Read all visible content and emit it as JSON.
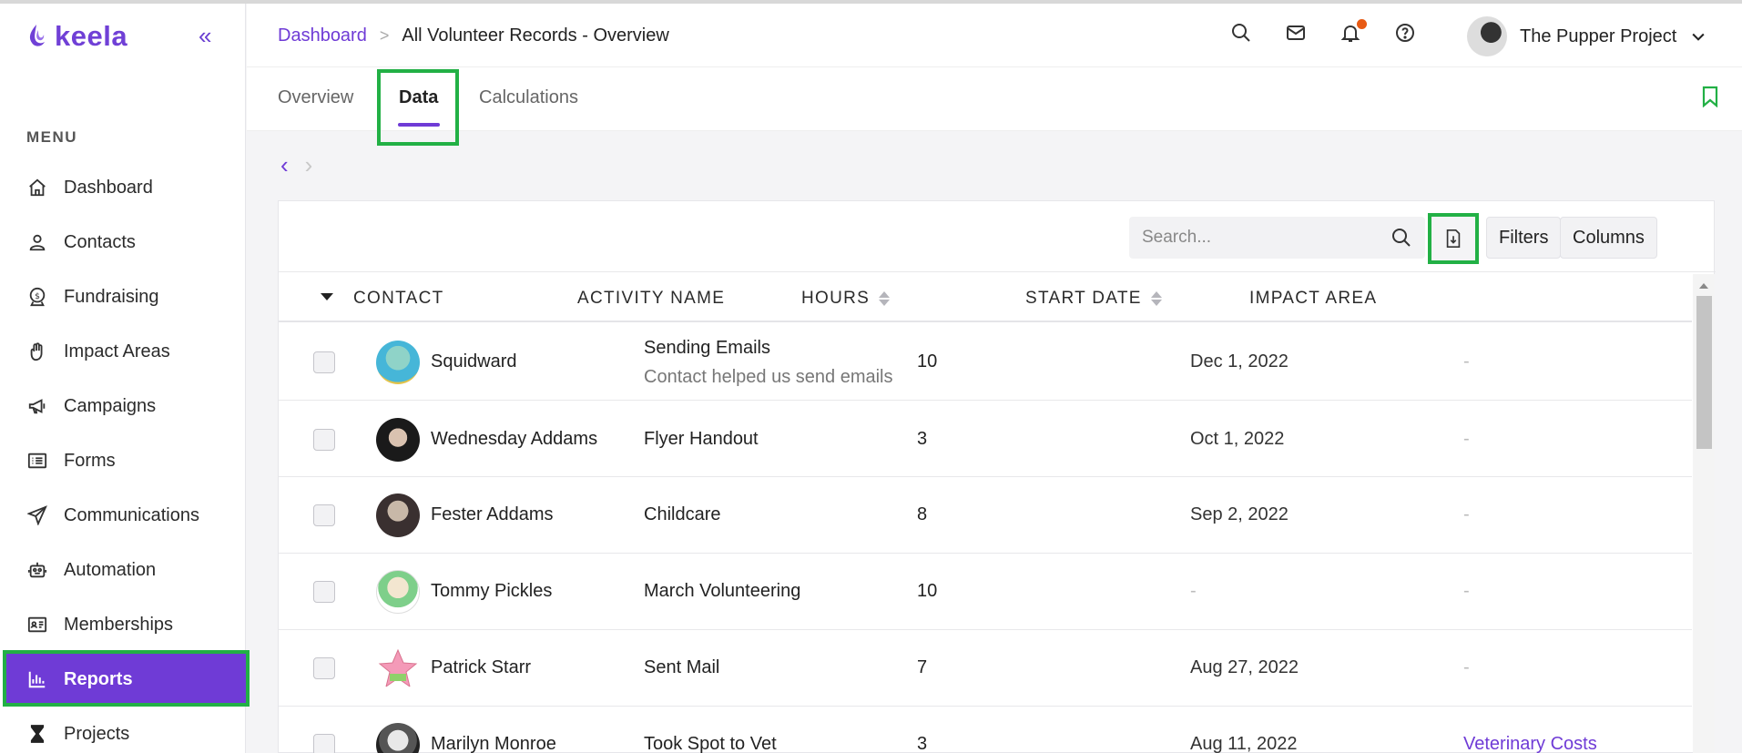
{
  "app": {
    "logo_text": "keela",
    "brand_color": "#6f3bd6",
    "highlight_color": "#22b045"
  },
  "sidebar": {
    "menu_title": "MENU",
    "items": [
      {
        "label": "Dashboard",
        "icon": "home-icon"
      },
      {
        "label": "Contacts",
        "icon": "person-icon"
      },
      {
        "label": "Fundraising",
        "icon": "dollar-badge-icon"
      },
      {
        "label": "Impact Areas",
        "icon": "hand-icon"
      },
      {
        "label": "Campaigns",
        "icon": "megaphone-icon"
      },
      {
        "label": "Forms",
        "icon": "list-icon"
      },
      {
        "label": "Communications",
        "icon": "paper-plane-icon"
      },
      {
        "label": "Automation",
        "icon": "robot-icon"
      },
      {
        "label": "Memberships",
        "icon": "id-card-icon"
      },
      {
        "label": "Reports",
        "icon": "bar-chart-icon",
        "active": true
      },
      {
        "label": "Projects",
        "icon": "hourglass-icon"
      }
    ]
  },
  "header": {
    "breadcrumb_link": "Dashboard",
    "breadcrumb_current": "All Volunteer Records - Overview",
    "org_name": "The Pupper Project"
  },
  "tabs": [
    {
      "label": "Overview"
    },
    {
      "label": "Data",
      "active": true
    },
    {
      "label": "Calculations"
    }
  ],
  "toolbar": {
    "search_placeholder": "Search...",
    "filters_label": "Filters",
    "columns_label": "Columns"
  },
  "table": {
    "columns": [
      "CONTACT",
      "ACTIVITY NAME",
      "HOURS",
      "START DATE",
      "IMPACT AREA"
    ],
    "rows": [
      {
        "contact": "Squidward",
        "activity": "Sending Emails",
        "activity_note": "Contact helped us send emails",
        "hours": "10",
        "start_date": "Dec 1, 2022",
        "impact_area": "-"
      },
      {
        "contact": "Wednesday Addams",
        "activity": "Flyer Handout",
        "hours": "3",
        "start_date": "Oct 1, 2022",
        "impact_area": "-"
      },
      {
        "contact": "Fester Addams",
        "activity": "Childcare",
        "hours": "8",
        "start_date": "Sep 2, 2022",
        "impact_area": "-"
      },
      {
        "contact": "Tommy Pickles",
        "activity": "March Volunteering",
        "hours": "10",
        "start_date": "-",
        "impact_area": "-"
      },
      {
        "contact": "Patrick Starr",
        "activity": "Sent Mail",
        "hours": "7",
        "start_date": "Aug 27, 2022",
        "impact_area": "-"
      },
      {
        "contact": "Marilyn Monroe",
        "activity": "Took Spot to Vet",
        "hours": "3",
        "start_date": "Aug 11, 2022",
        "impact_area": "Veterinary Costs"
      }
    ]
  }
}
